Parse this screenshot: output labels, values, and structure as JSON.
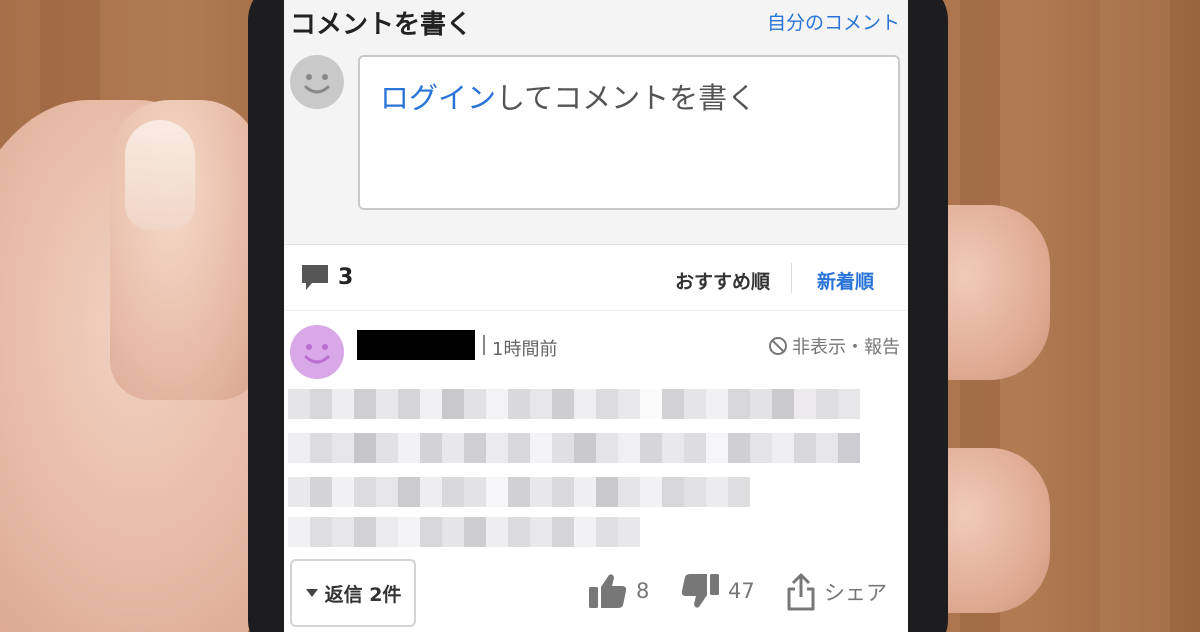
{
  "compose": {
    "title": "コメントを書く",
    "my_comments_link": "自分のコメント",
    "login_link": "ログイン",
    "placeholder_rest": "してコメントを書く"
  },
  "sort_bar": {
    "comment_count": "3",
    "sort_recommended": "おすすめ順",
    "sort_newest": "新着順",
    "active_sort": "新着順"
  },
  "comment": {
    "timestamp": "1時間前",
    "report_label": "非表示・報告",
    "reply_button": "返信 2件",
    "like_count": "8",
    "dislike_count": "47",
    "share_label": "シェア"
  },
  "colors": {
    "link": "#2a74d8",
    "avatar_default": "#c9c9c9",
    "avatar_commenter": "#d9a8e8"
  },
  "icons": {
    "comment_count": "speech-bubble-icon",
    "report": "prohibited-icon",
    "reply_toggle": "caret-down-icon",
    "like": "thumbs-up-icon",
    "dislike": "thumbs-down-icon",
    "share": "share-icon"
  }
}
